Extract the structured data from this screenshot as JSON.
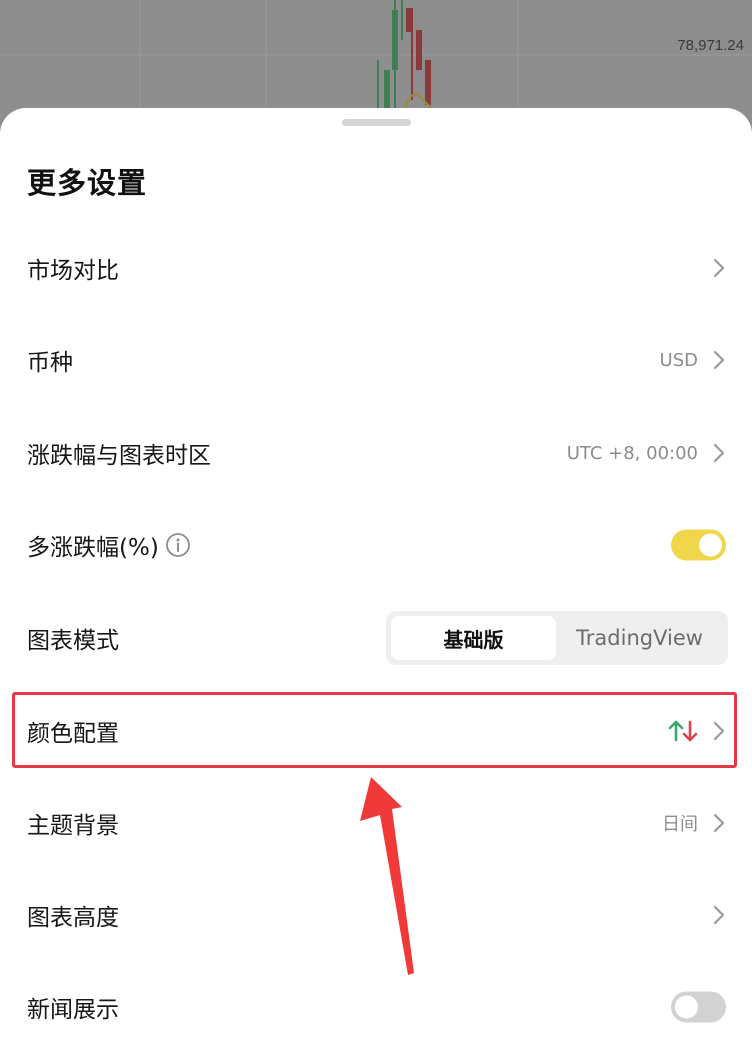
{
  "background": {
    "price_label": "78,971.24"
  },
  "sheet": {
    "title": "更多设置",
    "rows": [
      {
        "label": "市场对比",
        "value": ""
      },
      {
        "label": "币种",
        "value": "USD"
      },
      {
        "label": "涨跌幅与图表时区",
        "value": "UTC +8, 00:00"
      },
      {
        "label": "多涨跌幅(%)",
        "toggle": true
      },
      {
        "label": "图表模式",
        "options": [
          "基础版",
          "TradingView"
        ],
        "selected": "基础版"
      },
      {
        "label": "颜色配置",
        "value": ""
      },
      {
        "label": "主题背景",
        "value": "日间"
      },
      {
        "label": "图表高度",
        "value": ""
      },
      {
        "label": "新闻展示",
        "toggle": false
      }
    ]
  },
  "colors": {
    "accent_toggle_on": "#f0d64a",
    "toggle_off": "#d2d2d2",
    "highlight_annotation": "#e63946",
    "up_color": "#3aa86b",
    "down_color": "#e0414f"
  },
  "icons": {
    "chevron": "chevron-right-icon",
    "info": "info-circle-icon",
    "color_config": "up-down-arrows-icon"
  }
}
